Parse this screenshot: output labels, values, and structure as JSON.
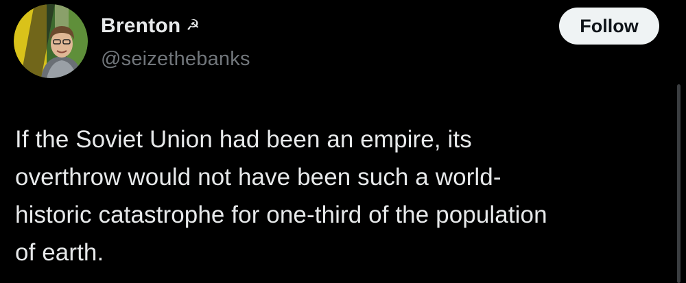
{
  "user": {
    "display_name": "Brenton",
    "name_emoji": "☭",
    "handle": "@seizethebanks",
    "avatar_icon": "profile-photo"
  },
  "actions": {
    "follow_label": "Follow"
  },
  "tweet": {
    "lines": [
      "If the Soviet Union had been an empire, its",
      "overthrow would not have been such a world-",
      "historic catastrophe for one-third of the population",
      "of earth."
    ]
  },
  "colors": {
    "background": "#000000",
    "primary_text": "#e7e9ea",
    "secondary_text": "#71767b",
    "button_bg": "#eff3f4",
    "button_text": "#0f1419"
  }
}
